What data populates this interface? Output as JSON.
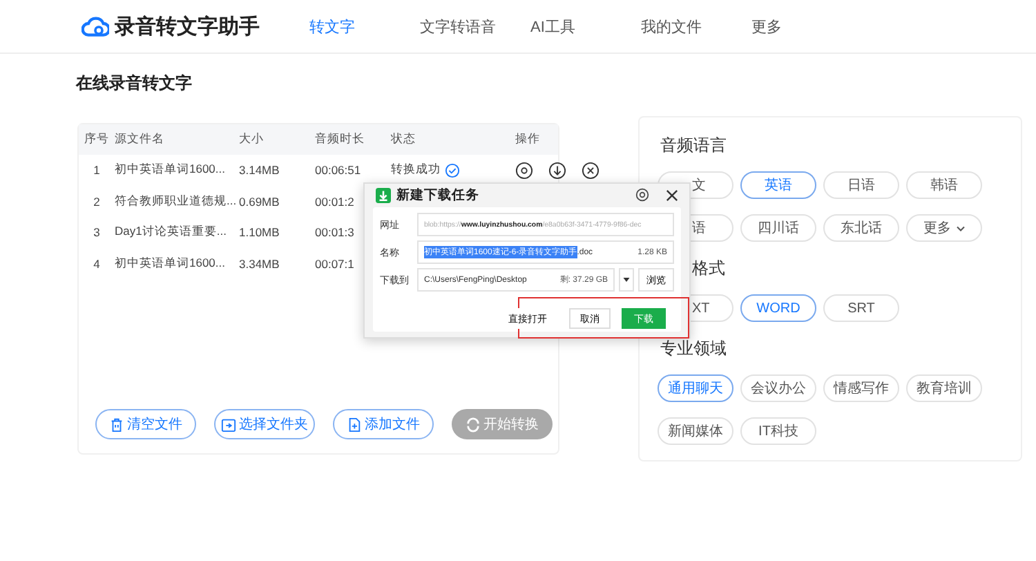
{
  "app": {
    "title": "录音转文字助手"
  },
  "nav": [
    {
      "label": "转文字",
      "selected": true
    },
    {
      "label": "文字转语音",
      "selected": false
    },
    {
      "label": "AI工具",
      "selected": false
    },
    {
      "label": "我的文件",
      "selected": false
    },
    {
      "label": "更多",
      "selected": false
    }
  ],
  "page_title": "在线录音转文字",
  "table": {
    "columns": [
      "序号",
      "源文件名",
      "大小",
      "音频时长",
      "状态",
      "操作"
    ],
    "rows": [
      {
        "index": "1",
        "name": "初中英语单词1600...",
        "size": "3.14MB",
        "duration": "00:06:51",
        "status": "转换成功"
      },
      {
        "index": "2",
        "name": "符合教师职业道德规...",
        "size": "0.69MB",
        "duration": "00:01:2"
      },
      {
        "index": "3",
        "name": "Day1讨论英语重要...",
        "size": "1.10MB",
        "duration": "00:01:3"
      },
      {
        "index": "4",
        "name": "初中英语单词1600...",
        "size": "3.34MB",
        "duration": "00:07:1"
      }
    ]
  },
  "actions": [
    {
      "label": "清空文件",
      "kind": "trash",
      "disabled": false
    },
    {
      "label": "选择文件夹",
      "kind": "folder",
      "disabled": false
    },
    {
      "label": "添加文件",
      "kind": "file",
      "disabled": false
    },
    {
      "label": "开始转换",
      "kind": "convert",
      "disabled": true
    }
  ],
  "options": [
    {
      "title": "音频语言",
      "items": [
        {
          "label": "文",
          "selected": false
        },
        {
          "label": "英语",
          "selected": true
        },
        {
          "label": "日语",
          "selected": false
        },
        {
          "label": "韩语",
          "selected": false
        },
        {
          "label": "语",
          "selected": false
        },
        {
          "label": "四川话",
          "selected": false
        },
        {
          "label": "东北话",
          "selected": false
        },
        {
          "label": "更多",
          "selected": false,
          "kind": "dropdown"
        }
      ]
    },
    {
      "title": "格式",
      "items": [
        {
          "label": "XT",
          "selected": false
        },
        {
          "label": "WORD",
          "selected": true
        },
        {
          "label": "SRT",
          "selected": false
        }
      ]
    },
    {
      "title": "专业领域",
      "items": [
        {
          "label": "通用聊天",
          "selected": true
        },
        {
          "label": "会议办公",
          "selected": false
        },
        {
          "label": "情感写作",
          "selected": false
        },
        {
          "label": "教育培训",
          "selected": false
        },
        {
          "label": "新闻媒体",
          "selected": false
        },
        {
          "label": "IT科技",
          "selected": false
        }
      ]
    }
  ],
  "dialog": {
    "title": "新建下载任务",
    "url_label": "网址",
    "url": "blob:https://**www.luyinzhushou.com**/e8a0b63f-3471-4779-9f86-dec",
    "name_label": "名称",
    "name_selected": "初中英语单词1600速记-6-录音转文字助手",
    "name_rest": ".doc",
    "file_size": "1.28 KB",
    "path_label": "下载到",
    "path": "C:\\Users\\FengPing\\Desktop",
    "free_space": "剩: 37.29 GB",
    "browse": "浏览",
    "buttons": [
      {
        "label": "直接打开",
        "kind": "plain"
      },
      {
        "label": "取消",
        "kind": "outline"
      },
      {
        "label": "下载",
        "kind": "primary"
      }
    ]
  }
}
